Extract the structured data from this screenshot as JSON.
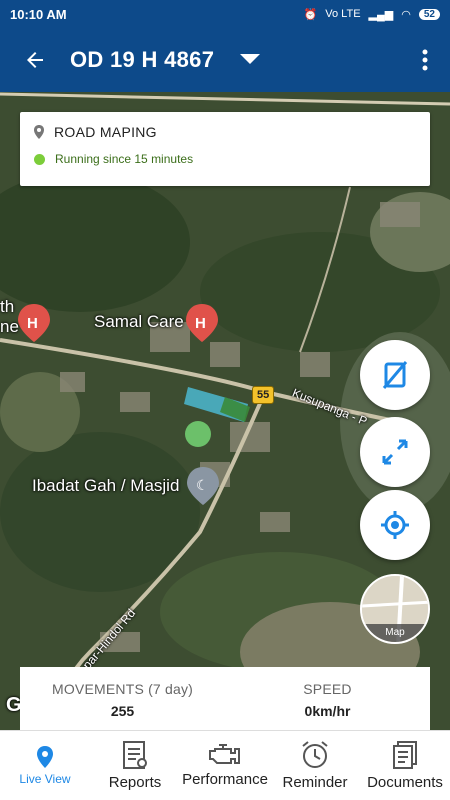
{
  "status_bar": {
    "time": "10:10 AM",
    "network": "Vo LTE",
    "battery": "52"
  },
  "app_bar": {
    "vehicle_number": "OD 19 H 4867"
  },
  "info_card": {
    "place": "ROAD MAPING",
    "status": "Running since 15 minutes",
    "status_color": "#7ccd3a"
  },
  "map": {
    "labels": {
      "place1": "Samal Care",
      "place2": "Ibadat Gah / Masjid",
      "place_partial": "th",
      "place_partial2": "ne",
      "road1": "Kusupanga - P",
      "road2": "par-Hindol Rd"
    },
    "road_number": "55",
    "google_letter": "G"
  },
  "map_toggle": {
    "label": "Map"
  },
  "stats": {
    "movements_label": "MOVEMENTS (7 day)",
    "movements_value": "255",
    "speed_label": "SPEED",
    "speed_value": "0km/hr"
  },
  "nav": {
    "items": [
      {
        "label": "Live View",
        "icon": "location-pin-icon"
      },
      {
        "label": "Reports",
        "icon": "report-document-icon"
      },
      {
        "label": "Performance",
        "icon": "engine-icon"
      },
      {
        "label": "Reminder",
        "icon": "alarm-clock-icon"
      },
      {
        "label": "Documents",
        "icon": "documents-icon"
      }
    ],
    "active_color": "#1e88e5"
  },
  "colors": {
    "app_bar": "#0d4a8a",
    "accent": "#1e88e5"
  }
}
